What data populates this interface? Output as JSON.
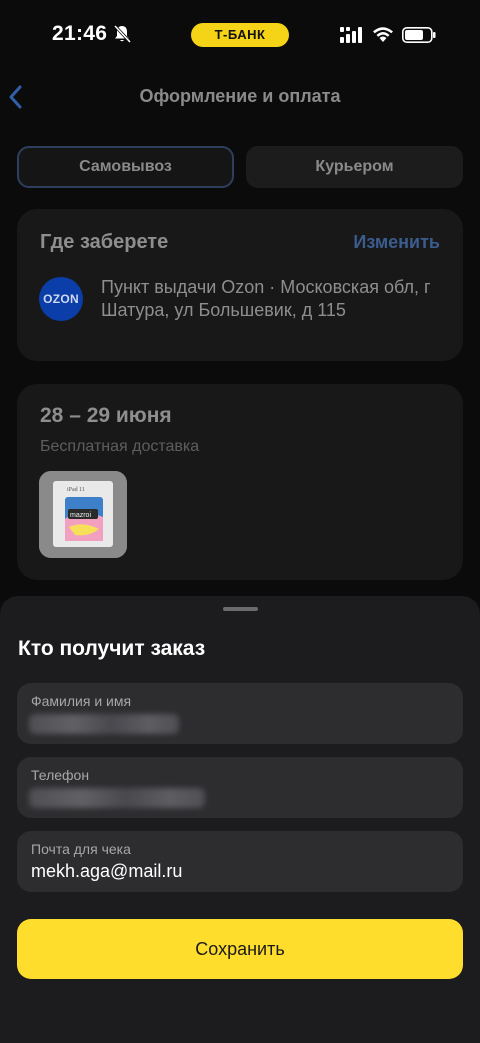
{
  "status_bar": {
    "time": "21:46",
    "carrier_pill": "Т-БАНК"
  },
  "nav": {
    "title": "Оформление и оплата"
  },
  "delivery_tabs": {
    "pickup": "Самовывоз",
    "courier": "Курьером",
    "selected": "pickup"
  },
  "pickup_card": {
    "title": "Где заберете",
    "change_link": "Изменить",
    "logo_text": "OZON",
    "address": "Пункт выдачи Ozon · Московская обл, г Шатура, ул Большевик, д 115"
  },
  "delivery_card": {
    "dates": "28 – 29 июня",
    "shipping": "Бесплатная доставка",
    "product_image": "ipad-box"
  },
  "recipient_sheet": {
    "title": "Кто получит заказ",
    "fields": [
      {
        "label": "Фамилия и имя",
        "value_hidden": true
      },
      {
        "label": "Телефон",
        "value_hidden": true
      },
      {
        "label": "Почта для чека",
        "value": "mekh.aga@mail.ru"
      }
    ],
    "save_button": "Сохранить"
  },
  "colors": {
    "accent_yellow": "#ffdd2d",
    "link_blue": "#3b5c8e",
    "sheet_bg": "#1c1c1e",
    "field_bg": "#2d2d30"
  }
}
